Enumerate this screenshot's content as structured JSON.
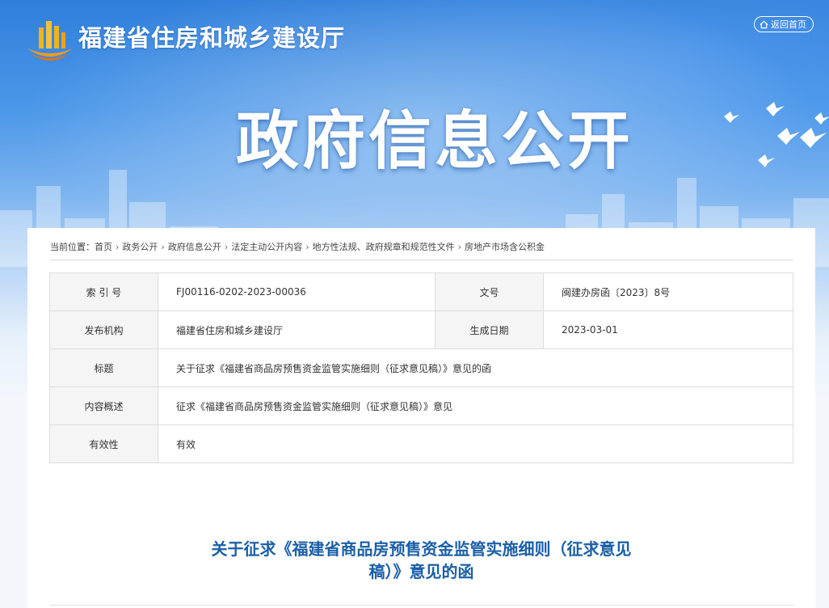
{
  "header": {
    "site_name": "福建省住房和城乡建设厅",
    "back_home": "返回首页",
    "banner_title": "政府信息公开"
  },
  "breadcrumb": {
    "label": "当前位置：",
    "items": [
      "首页",
      "政务公开",
      "政府信息公开",
      "法定主动公开内容",
      "地方性法规、政府规章和规范性文件",
      "房地产市场含公积金"
    ]
  },
  "meta": {
    "index_no_label": "索 引 号",
    "index_no": "FJ00116-0202-2023-00036",
    "doc_no_label": "文号",
    "doc_no": "闽建办房函〔2023〕8号",
    "publisher_label": "发布机构",
    "publisher": "福建省住房和城乡建设厅",
    "date_label": "生成日期",
    "date": "2023-03-01",
    "title_label": "标题",
    "title": "关于征求《福建省商品房预售资金监管实施细则（征求意见稿）》意见的函",
    "summary_label": "内容概述",
    "summary": "征求《福建省商品房预售资金监管实施细则（征求意见稿）》意见",
    "validity_label": "有效性",
    "validity": "有效"
  },
  "article": {
    "title_line1": "关于征求《福建省商品房预售资金监管实施细则（征求意见",
    "title_line2": "稿）》意见的函"
  },
  "colors": {
    "banner_top": "#2f7fdc",
    "title_blue": "#1a5fa8",
    "label_bg": "#f5f5f5"
  }
}
